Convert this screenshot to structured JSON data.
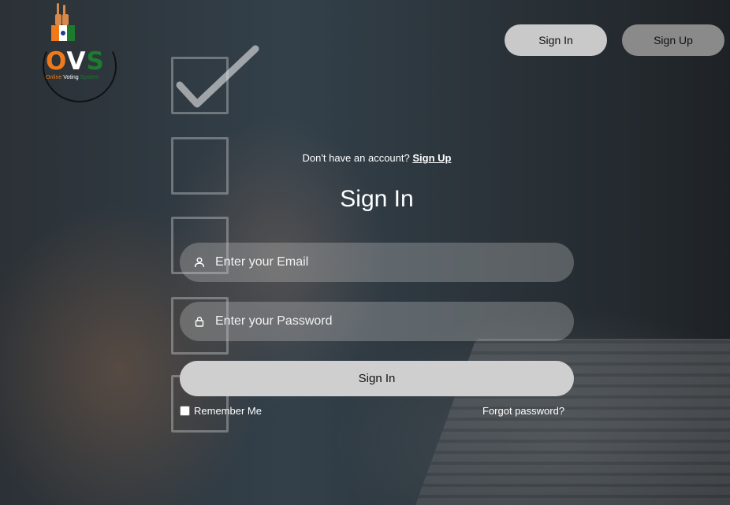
{
  "logo": {
    "letters": {
      "o": "O",
      "v": "V",
      "s": "S"
    },
    "tagline": {
      "part1": "Online ",
      "part2": "Voting ",
      "part3": "System"
    },
    "colors": {
      "saffron": "#f07a1a",
      "white": "#ffffff",
      "green": "#1e7a2e"
    }
  },
  "nav": {
    "signin_label": "Sign In",
    "signup_label": "Sign Up"
  },
  "form": {
    "prompt_text": "Don't have an account?",
    "prompt_link": "Sign Up",
    "title": "Sign In",
    "email_placeholder": "Enter your Email",
    "email_icon": "user-icon",
    "password_placeholder": "Enter your Password",
    "password_icon": "lock-icon",
    "submit_label": "Sign In",
    "remember_label": "Remember Me",
    "remember_checked": false,
    "forgot_label": "Forgot password?"
  }
}
